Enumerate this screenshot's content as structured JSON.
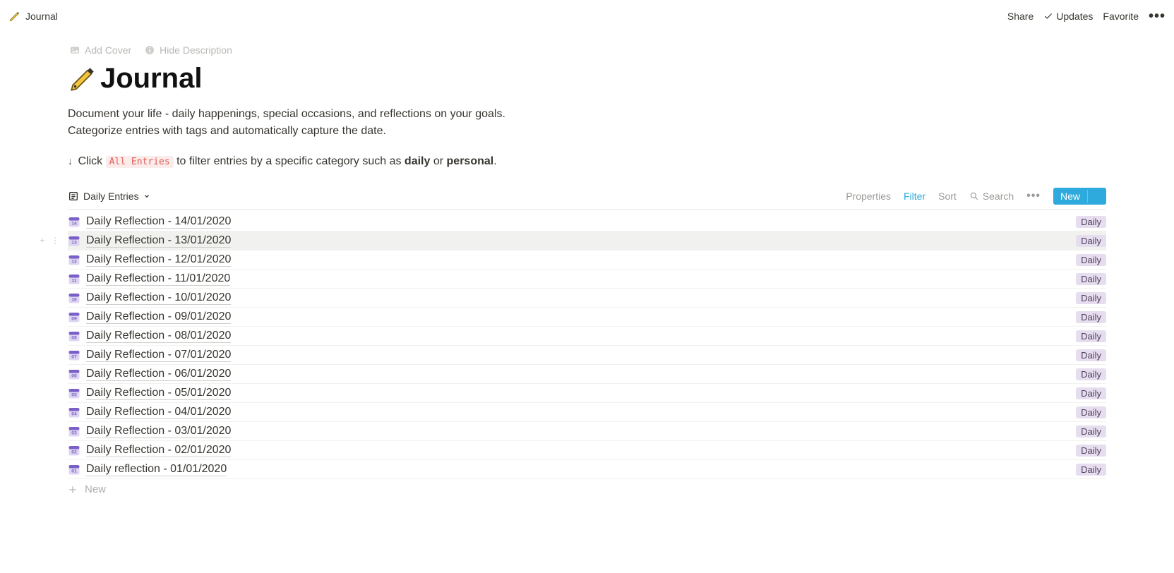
{
  "breadcrumb": {
    "title": "Journal"
  },
  "topbar": {
    "share": "Share",
    "updates": "Updates",
    "favorite": "Favorite"
  },
  "cover_actions": {
    "add_cover": "Add Cover",
    "hide_description": "Hide Description"
  },
  "page": {
    "title": "Journal",
    "description_line1": "Document your life - daily happenings, special occasions, and reflections on your goals.",
    "description_line2": "Categorize entries with tags and automatically capture the date.",
    "hint_pre": "Click ",
    "hint_code": "All Entries",
    "hint_mid": " to filter entries by a specific category such as ",
    "hint_bold1": "daily",
    "hint_or": " or ",
    "hint_bold2": "personal",
    "hint_end": "."
  },
  "database": {
    "view_name": "Daily Entries",
    "tools": {
      "properties": "Properties",
      "filter": "Filter",
      "sort": "Sort",
      "search": "Search",
      "new": "New"
    },
    "entries": [
      {
        "day": "14",
        "title": "Daily Reflection - 14/01/2020",
        "tag": "Daily",
        "hover": false
      },
      {
        "day": "13",
        "title": "Daily Reflection - 13/01/2020",
        "tag": "Daily",
        "hover": true
      },
      {
        "day": "12",
        "title": "Daily Reflection - 12/01/2020",
        "tag": "Daily",
        "hover": false
      },
      {
        "day": "11",
        "title": "Daily Reflection - 11/01/2020",
        "tag": "Daily",
        "hover": false
      },
      {
        "day": "10",
        "title": "Daily Reflection - 10/01/2020",
        "tag": "Daily",
        "hover": false
      },
      {
        "day": "09",
        "title": "Daily Reflection - 09/01/2020",
        "tag": "Daily",
        "hover": false
      },
      {
        "day": "08",
        "title": "Daily Reflection - 08/01/2020",
        "tag": "Daily",
        "hover": false
      },
      {
        "day": "07",
        "title": "Daily Reflection - 07/01/2020",
        "tag": "Daily",
        "hover": false
      },
      {
        "day": "06",
        "title": "Daily Reflection - 06/01/2020",
        "tag": "Daily",
        "hover": false
      },
      {
        "day": "05",
        "title": "Daily Reflection - 05/01/2020",
        "tag": "Daily",
        "hover": false
      },
      {
        "day": "04",
        "title": "Daily Reflection - 04/01/2020",
        "tag": "Daily",
        "hover": false
      },
      {
        "day": "03",
        "title": "Daily Reflection - 03/01/2020",
        "tag": "Daily",
        "hover": false
      },
      {
        "day": "02",
        "title": "Daily Reflection - 02/01/2020",
        "tag": "Daily",
        "hover": false
      },
      {
        "day": "01",
        "title": "Daily reflection - 01/01/2020",
        "tag": "Daily",
        "hover": false
      }
    ],
    "new_row": "New"
  }
}
